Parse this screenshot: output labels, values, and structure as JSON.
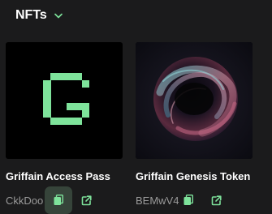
{
  "header": {
    "title": "NFTs",
    "dropdown_icon": "chevron-down-icon"
  },
  "colors": {
    "background": "#1b1b1c",
    "accent": "#7ee39b",
    "text": "#ffffff",
    "muted": "#9a9a9a"
  },
  "nfts": [
    {
      "name": "Griffain Access Pass",
      "address": "CkkDoo",
      "image": "pixel-letter-g-logo",
      "copy_icon": "copy-icon",
      "link_icon": "external-link-icon"
    },
    {
      "name": "Griffain Genesis Token",
      "address": "BEMwV4",
      "image": "swirl-orb-artwork",
      "copy_icon": "copy-icon",
      "link_icon": "external-link-icon"
    }
  ]
}
